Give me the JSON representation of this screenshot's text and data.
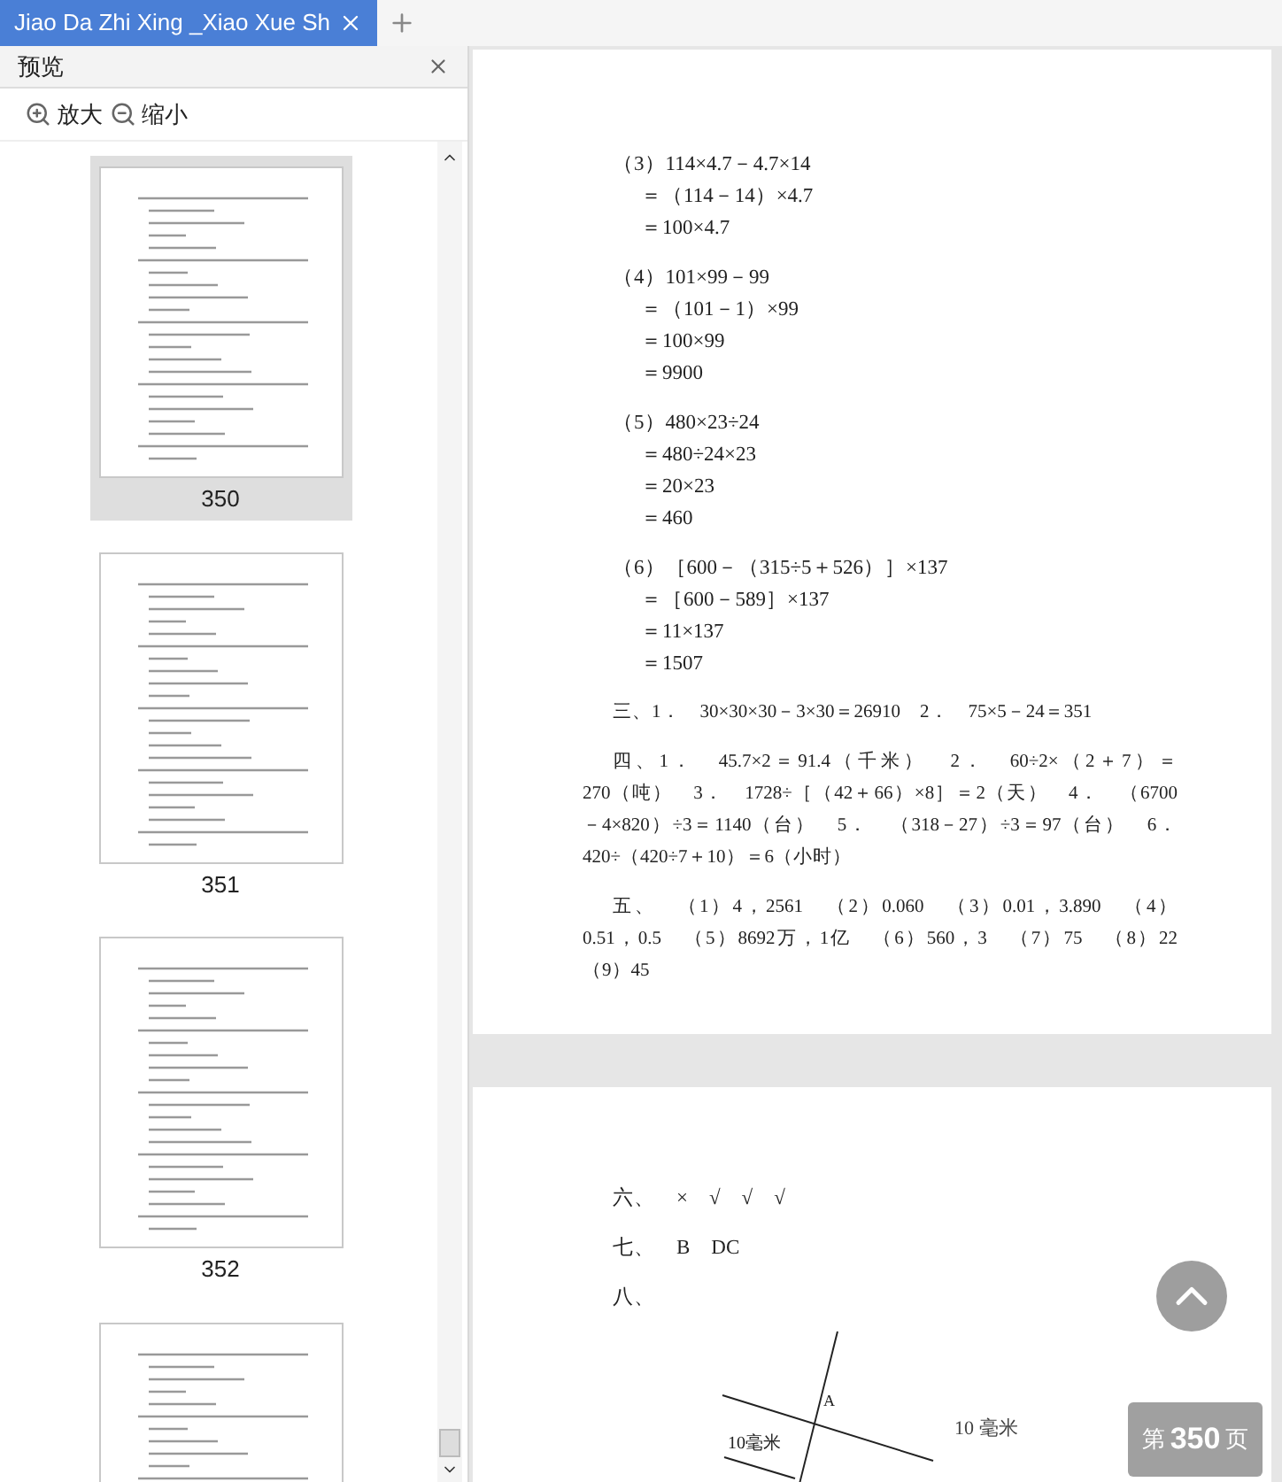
{
  "tab": {
    "title": "Jiao Da Zhi Xing _Xiao Xue Sh",
    "selected": true
  },
  "panel": {
    "title": "预览",
    "zoom_in": "放大",
    "zoom_out": "缩小"
  },
  "thumbnails": [
    {
      "label": "350",
      "selected": true
    },
    {
      "label": "351",
      "selected": false
    },
    {
      "label": "352",
      "selected": false
    },
    {
      "selected": false
    }
  ],
  "page_1": [
    {
      "kind": "steps",
      "lines": [
        "（3）114×4.7－4.7×14",
        "＝（114－14）×4.7",
        "＝100×4.7"
      ]
    },
    {
      "kind": "steps",
      "lines": [
        "（4）101×99－99",
        "＝（101－1）×99",
        "＝100×99",
        "＝9900"
      ]
    },
    {
      "kind": "steps",
      "lines": [
        "（5）480×23÷24",
        "＝480÷24×23",
        "＝20×23",
        "＝460"
      ]
    },
    {
      "kind": "steps",
      "lines": [
        "（6）［600－（315÷5＋526）］×137",
        "＝［600－589］×137",
        "＝11×137",
        "＝1507"
      ]
    },
    {
      "kind": "paragraph",
      "lines": [
        "三、1．　30×30×30－3×30＝26910　2．　75×5－24＝351"
      ]
    },
    {
      "kind": "paragraph",
      "lines": [
        "四、1．　45.7×2＝91.4（千米）　2．　60÷2×（2＋7）＝",
        "270（吨）　3．　1728÷［（42＋66）×8］＝2（天）　4．　（6700",
        "－4×820）÷3＝1140（台）　5．　（318－27）÷3＝97（台）　6．",
        "420÷（420÷7＋10）＝6（小时）"
      ]
    },
    {
      "kind": "paragraph",
      "lines": [
        "五、　（1）4，2561　（2）0.060　（3）0.01，3.890　（4）",
        "0.51，0.5　（5）8692万，1亿　（6）560，3　（7）75　（8）22",
        "（9）45"
      ]
    }
  ],
  "page_2": {
    "lines": [
      "六、　×　√　√　√",
      "七、　B　DC",
      "八、"
    ],
    "diagram": {
      "point_label": "A",
      "distance_label": "10毫米",
      "side_label": "10 毫米"
    }
  },
  "page_indicator": {
    "prefix": "第",
    "number": "350",
    "suffix": "页"
  }
}
